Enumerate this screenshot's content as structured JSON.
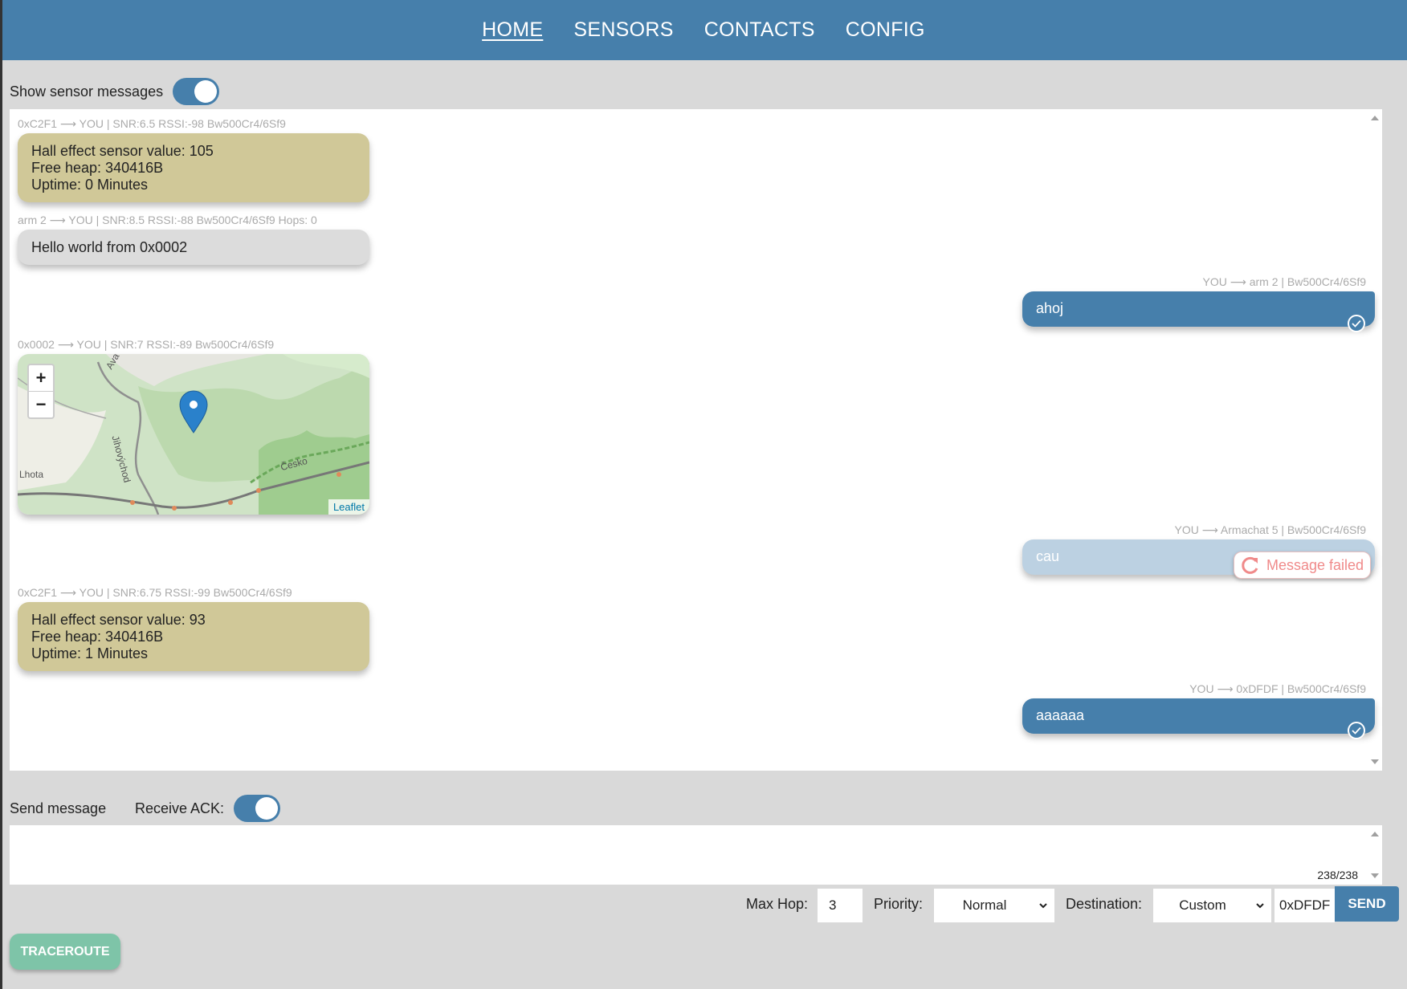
{
  "nav": {
    "items": [
      "HOME",
      "SENSORS",
      "CONTACTS",
      "CONFIG"
    ],
    "active": "HOME"
  },
  "sensor_toggle": {
    "label": "Show sensor messages",
    "on": true
  },
  "messages": [
    {
      "meta": "0xC2F1 ⟶ YOU | SNR:6.5 RSSI:-98 Bw500Cr4/6Sf9",
      "lines": [
        "Hall effect sensor value: 105",
        "Free heap: 340416B",
        "Uptime: 0 Minutes"
      ]
    },
    {
      "meta": "arm 2 ⟶ YOU | SNR:8.5 RSSI:-88 Bw500Cr4/6Sf9 Hops: 0",
      "text": "Hello world from 0x0002"
    },
    {
      "meta": "YOU ⟶ arm 2 | Bw500Cr4/6Sf9",
      "text": "ahoj",
      "status": "acknowledged"
    },
    {
      "meta": "0x0002 ⟶ YOU | SNR:7 RSSI:-89 Bw500Cr4/6Sf9",
      "map": {
        "zoom_in": "+",
        "zoom_out": "−",
        "attribution": "Leaflet",
        "labels": [
          "Lhota",
          "Jihovýchod",
          "Česko",
          "Ava"
        ]
      }
    },
    {
      "meta": "YOU ⟶ Armachat 5 | Bw500Cr4/6Sf9",
      "text": "cau",
      "status": "failed",
      "failed_label": "Message failed"
    },
    {
      "meta": "0xC2F1 ⟶ YOU | SNR:6.75 RSSI:-99 Bw500Cr4/6Sf9",
      "lines": [
        "Hall effect sensor value: 93",
        "Free heap: 340416B",
        "Uptime: 1 Minutes"
      ]
    },
    {
      "meta": "YOU ⟶ 0xDFDF | Bw500Cr4/6Sf9",
      "text": "aaaaaa",
      "status": "acknowledged"
    }
  ],
  "composer": {
    "send_label": "Send message",
    "ack_label": "Receive ACK:",
    "ack_on": true,
    "counter": "238/238",
    "message_value": ""
  },
  "controls": {
    "max_hop_label": "Max Hop:",
    "max_hop_value": "3",
    "priority_label": "Priority:",
    "priority_value": "Normal",
    "destination_label": "Destination:",
    "destination_value": "Custom",
    "destination_address": "0xDFDF",
    "send_button": "SEND"
  },
  "traceroute_button": "TRACEROUTE",
  "colors": {
    "primary": "#467fab",
    "sensor_bubble": "#d0c898",
    "incoming_bubble": "#dcdcdc",
    "failed_bubble": "#bcd1e2",
    "failed_text": "#f08a8a",
    "traceroute": "#7ec4a8",
    "background": "#d9d9d9"
  },
  "icons": [
    "check-icon",
    "retry-icon",
    "map-marker-icon",
    "chevron-down-icon"
  ]
}
